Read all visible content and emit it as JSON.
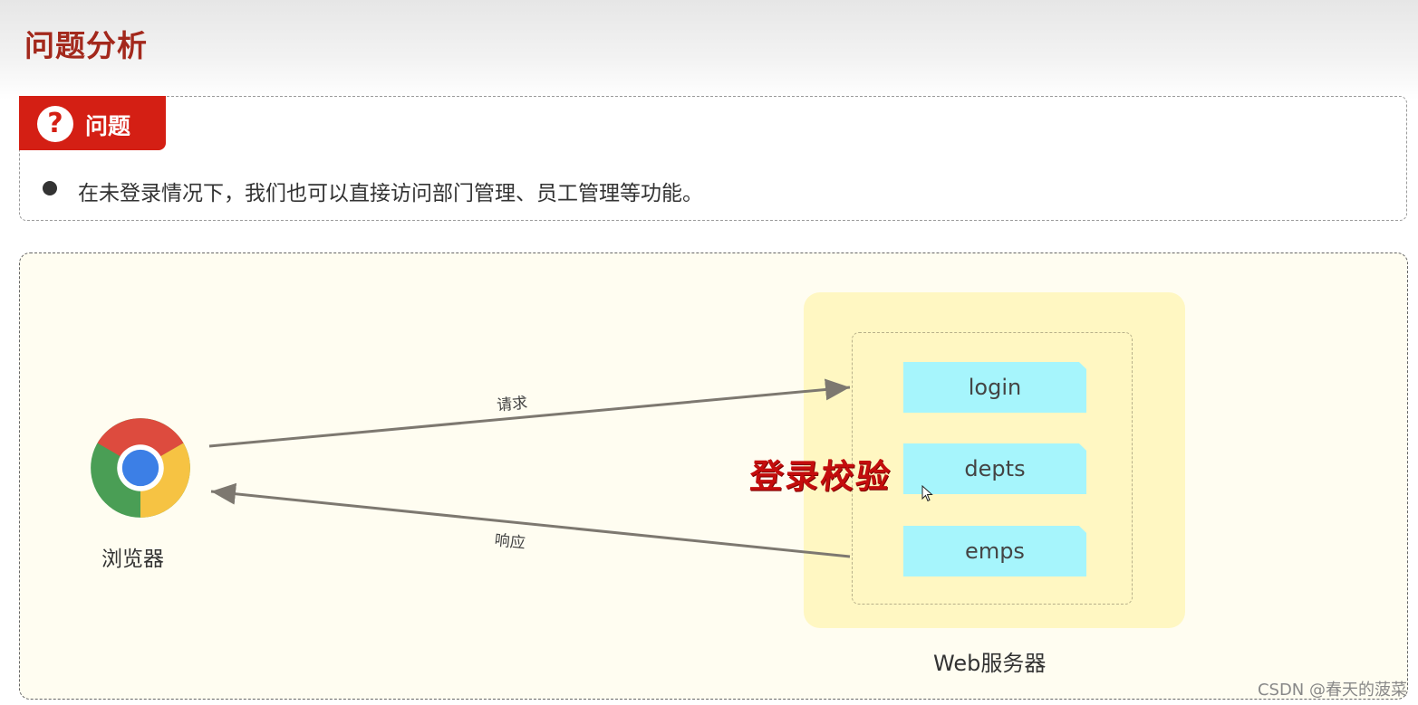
{
  "page": {
    "title": "问题分析"
  },
  "problem": {
    "tab_icon": "question-circle-icon",
    "tab_label": "问题",
    "bullet": "在未登录情况下，我们也可以直接访问部门管理、员工管理等功能。"
  },
  "diagram": {
    "browser": {
      "icon": "chrome-browser-icon",
      "label": "浏览器"
    },
    "request_label": "请求",
    "response_label": "响应",
    "overlay": "登录校验",
    "server": {
      "label": "Web服务器",
      "endpoints": [
        "login",
        "depts",
        "emps"
      ]
    }
  },
  "colors": {
    "title": "#a3281c",
    "tab": "#d41f14",
    "server_bg": "#fff7c2",
    "endpoint_bg": "#a6f5fc",
    "overlay": "#c40d0d",
    "panel_bg": "#fffdf1"
  },
  "watermark": "CSDN @春天的菠菜"
}
